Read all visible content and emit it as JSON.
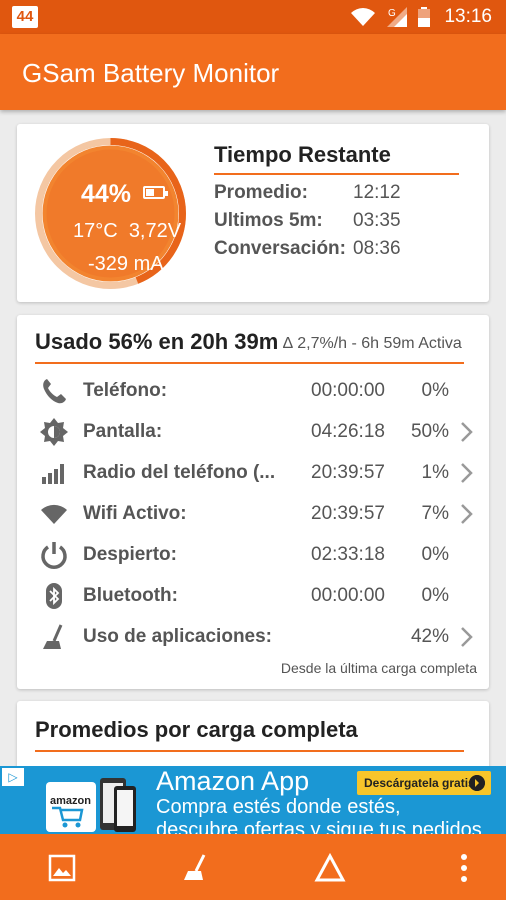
{
  "status_bar": {
    "badge": "44",
    "signal_label": "G",
    "time": "13:16"
  },
  "app": {
    "title": "GSam Battery Monitor"
  },
  "battery": {
    "percent": "44%",
    "level": 0.44,
    "temperature": "17°C",
    "voltage": "3,72V",
    "current": "-329 mA"
  },
  "remaining": {
    "title": "Tiempo Restante",
    "rows": [
      {
        "label": "Promedio:",
        "value": "12:12"
      },
      {
        "label": "Ultimos 5m:",
        "value": "03:35"
      },
      {
        "label": "Conversación:",
        "value": "08:36"
      }
    ]
  },
  "usage": {
    "title": "Usado 56% en 20h 39m",
    "rate": "∆ 2,7%/h - 6h 59m Activa",
    "rows": [
      {
        "icon": "phone-icon",
        "label": "Teléfono:",
        "time": "00:00:00",
        "pct": "0%",
        "chevron": false
      },
      {
        "icon": "brightness-icon",
        "label": "Pantalla:",
        "time": "04:26:18",
        "pct": "50%",
        "chevron": true
      },
      {
        "icon": "signal-bars-icon",
        "label": "Radio del teléfono (...",
        "time": "20:39:57",
        "pct": "1%",
        "chevron": true
      },
      {
        "icon": "wifi-icon",
        "label": "Wifi Activo:",
        "time": "20:39:57",
        "pct": "7%",
        "chevron": true
      },
      {
        "icon": "power-icon",
        "label": "Despierto:",
        "time": "02:33:18",
        "pct": "0%",
        "chevron": false
      },
      {
        "icon": "bluetooth-icon",
        "label": "Bluetooth:",
        "time": "00:00:00",
        "pct": "0%",
        "chevron": false
      },
      {
        "icon": "broom-icon",
        "label": "Uso de aplicaciones:",
        "time": "",
        "pct": "42%",
        "chevron": true
      }
    ],
    "footer": "Desde la última carga completa"
  },
  "averages": {
    "title": "Promedios por carga completa"
  },
  "ad": {
    "info": "▷",
    "brand": "amazon",
    "title": "Amazon App",
    "line1": "Compra estés donde estés,",
    "line2": "descubre ofertas y sigue tus pedidos",
    "button": "Descárgatela gratis"
  },
  "bottom_nav": {
    "items": [
      "image-icon",
      "broom-icon",
      "triangle-icon",
      "more-vert-icon"
    ]
  },
  "colors": {
    "primary": "#f26d1d",
    "primary_dark": "#e0570f",
    "ad_blue": "#1b97d4"
  }
}
